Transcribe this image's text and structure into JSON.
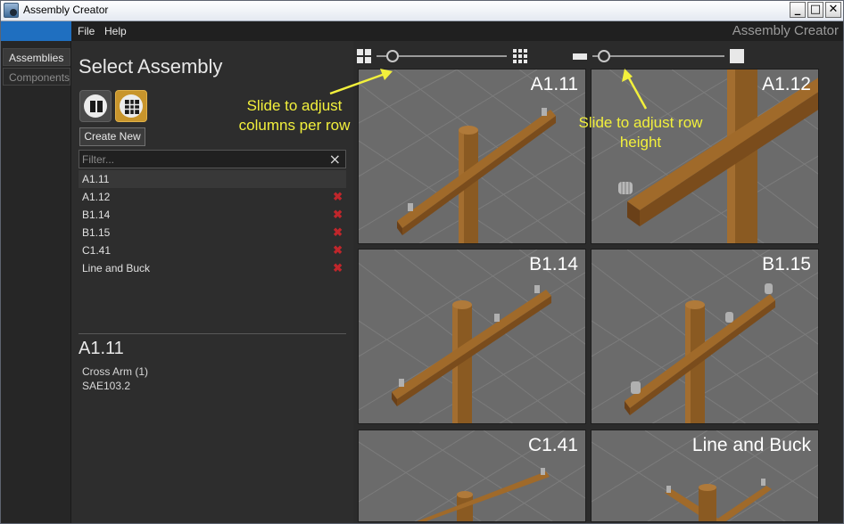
{
  "window": {
    "title": "Assembly Creator",
    "minimize": "_",
    "maximize": "□",
    "close": "✕"
  },
  "menu": {
    "file": "File",
    "help": "Help",
    "brand": "Assembly Creator"
  },
  "side_tabs": {
    "assemblies": "Assemblies",
    "components": "Components"
  },
  "panel": {
    "title": "Select Assembly",
    "create_new": "Create New",
    "filter_placeholder": "Filter...",
    "clear_icon": "×",
    "assemblies": [
      {
        "label": "A1.11",
        "selected": true,
        "deletable": false
      },
      {
        "label": "A1.12",
        "selected": false,
        "deletable": true
      },
      {
        "label": "B1.14",
        "selected": false,
        "deletable": true
      },
      {
        "label": "B1.15",
        "selected": false,
        "deletable": true
      },
      {
        "label": "C1.41",
        "selected": false,
        "deletable": true
      },
      {
        "label": "Line and Buck",
        "selected": false,
        "deletable": true
      }
    ],
    "delete_icon": "✖",
    "detail": {
      "title": "A1.11",
      "line1": "Cross Arm (1)",
      "line2": "SAE103.2"
    }
  },
  "sliders": {
    "columns_per_row": {
      "value_fraction": 0.12
    },
    "row_height": {
      "value_fraction": 0.09
    }
  },
  "tiles": [
    {
      "label": "A1.11"
    },
    {
      "label": "A1.12"
    },
    {
      "label": "B1.14"
    },
    {
      "label": "B1.15"
    },
    {
      "label": "C1.41"
    },
    {
      "label": "Line and Buck"
    }
  ],
  "annotations": {
    "columns": "Slide to adjust columns per row",
    "height": "Slide to adjust row height"
  },
  "colors": {
    "accent": "#1f6fc0",
    "selected_view": "#c8952c",
    "annotation": "#f2f03c",
    "delete": "#c0262b",
    "wood": "#8a5a22"
  },
  "icons": {
    "list_view": "list-view-icon",
    "grid_view": "grid-view-icon",
    "columns_few": "grid-2x2-icon",
    "columns_many": "grid-3x3-icon",
    "height_small": "row-small-icon",
    "height_large": "row-large-icon"
  }
}
